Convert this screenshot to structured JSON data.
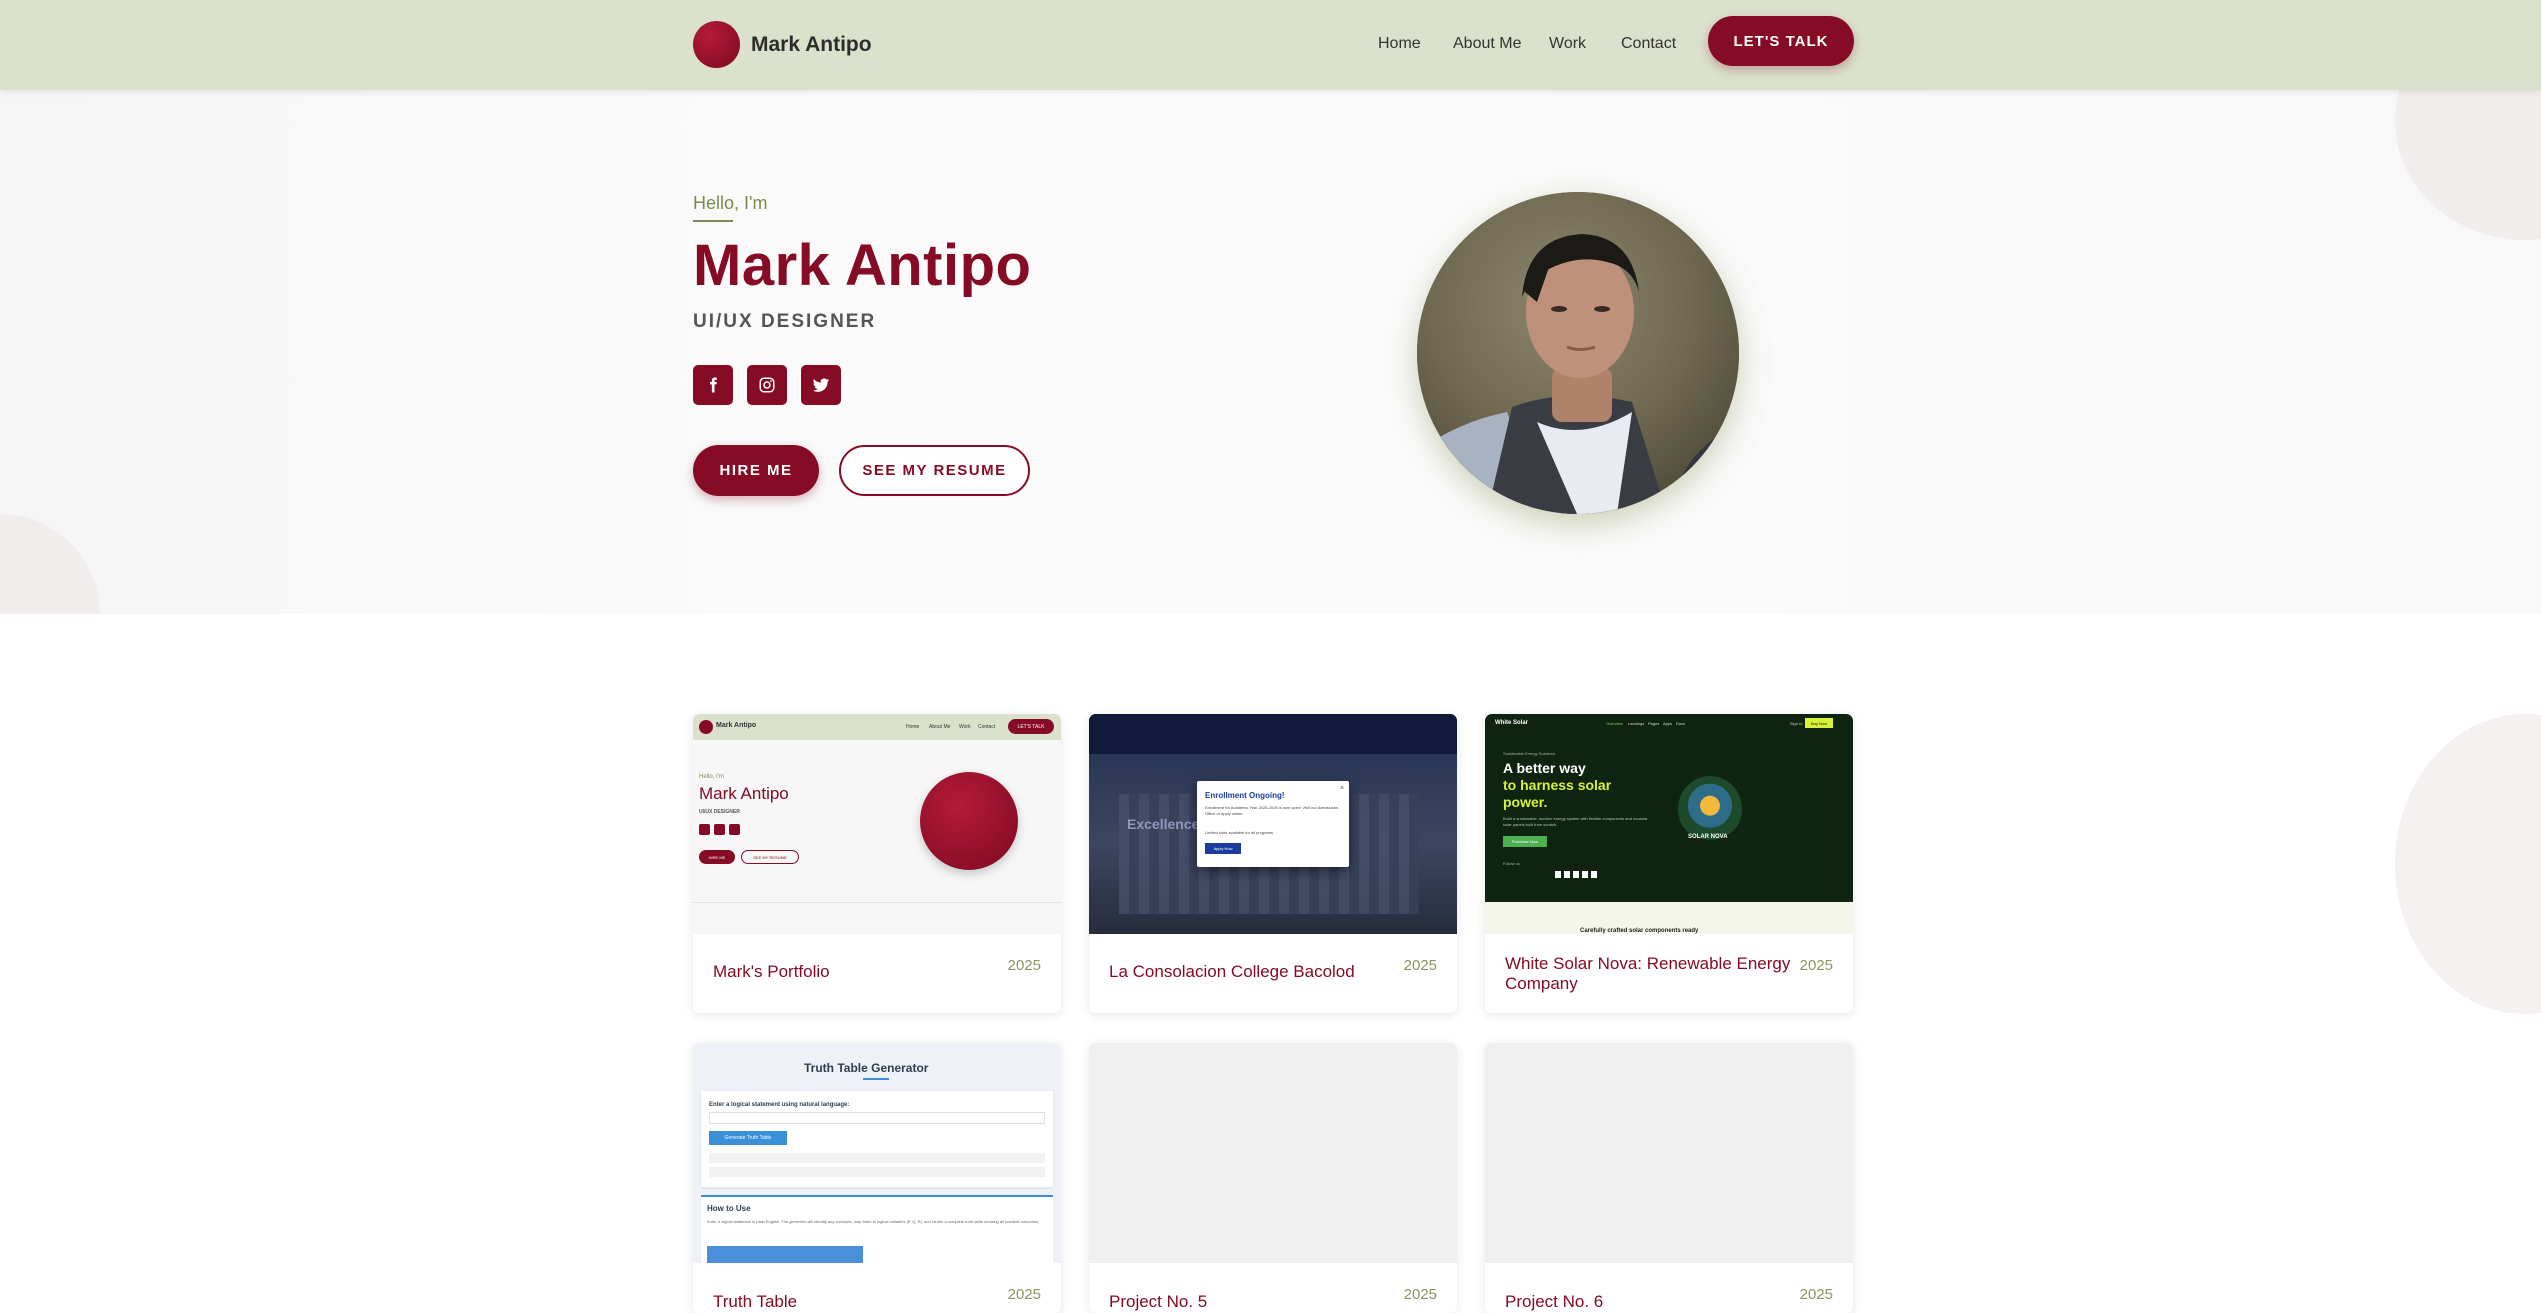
{
  "header": {
    "brand_name": "Mark Antipo",
    "nav": [
      "Home",
      "About Me",
      "Work",
      "Contact"
    ],
    "cta_label": "LET'S TALK"
  },
  "hero": {
    "greeting": "Hello, I'm",
    "name": "Mark Antipo",
    "role": "UI/UX DESIGNER",
    "social_icons": [
      "facebook-icon",
      "instagram-icon",
      "twitter-icon"
    ],
    "hire_label": "HIRE ME",
    "resume_label": "SEE MY RESUME"
  },
  "projects": [
    {
      "title": "Mark's Portfolio",
      "year": "2025"
    },
    {
      "title": "La Consolacion College Bacolod",
      "year": "2025"
    },
    {
      "title": "White Solar Nova: Renewable Energy Company",
      "year": "2025"
    },
    {
      "title": "Truth Table",
      "year": "2025"
    },
    {
      "title": "Project No. 5",
      "year": "2025"
    },
    {
      "title": "Project No. 6",
      "year": "2025"
    }
  ],
  "thumbnails": {
    "portfolio": {
      "brand": "Mark Antipo",
      "nav": [
        "Home",
        "About Me",
        "Work",
        "Contact"
      ],
      "cta": "LET'S TALK",
      "greeting": "Hello, I'm",
      "name": "Mark Antipo",
      "role": "UI/UX DESIGNER",
      "hire": "HIRE ME",
      "resume": "SEE MY RESUME"
    },
    "college": {
      "modal_title": "Enrollment Ongoing!",
      "modal_text": "Enrollment for Academic Year 2025-2026 is now open! Visit our Admissions Office or apply online.",
      "modal_note": "Limited slots available for all programs",
      "modal_button": "Apply Now",
      "hero_text": "Excellence i"
    },
    "solar": {
      "brand": "White Solar",
      "nav": [
        "Overview",
        "Landings",
        "Pages",
        "Apps",
        "Docs"
      ],
      "signin": "Sign In",
      "buy": "Buy Now",
      "kicker": "Sustainable Energy Solutions",
      "headline_1": "A better way",
      "headline_2": "to harness solar",
      "headline_3": "power.",
      "body": "Build a sustainable, modern energy system with flexible components and modular solar panels built from scratch.",
      "button": "Purchase Now",
      "follow": "Follow us",
      "logo_text": "SOLAR NOVA",
      "footer": "Carefully crafted solar components ready"
    },
    "truth": {
      "title": "Truth Table Generator",
      "prompt": "Enter a logical statement using natural language:",
      "button": "Generate Truth Table",
      "howto": "How to Use",
      "howto_text": "Enter a logical statement in plain English. The generator will identify any concepts, map them to logical variables (P, Q, R), and render a complete truth table showing all possible outcomes."
    }
  },
  "colors": {
    "accent": "#860b25",
    "header_bg": "#dbe2cb",
    "olive": "#7c8a52"
  }
}
